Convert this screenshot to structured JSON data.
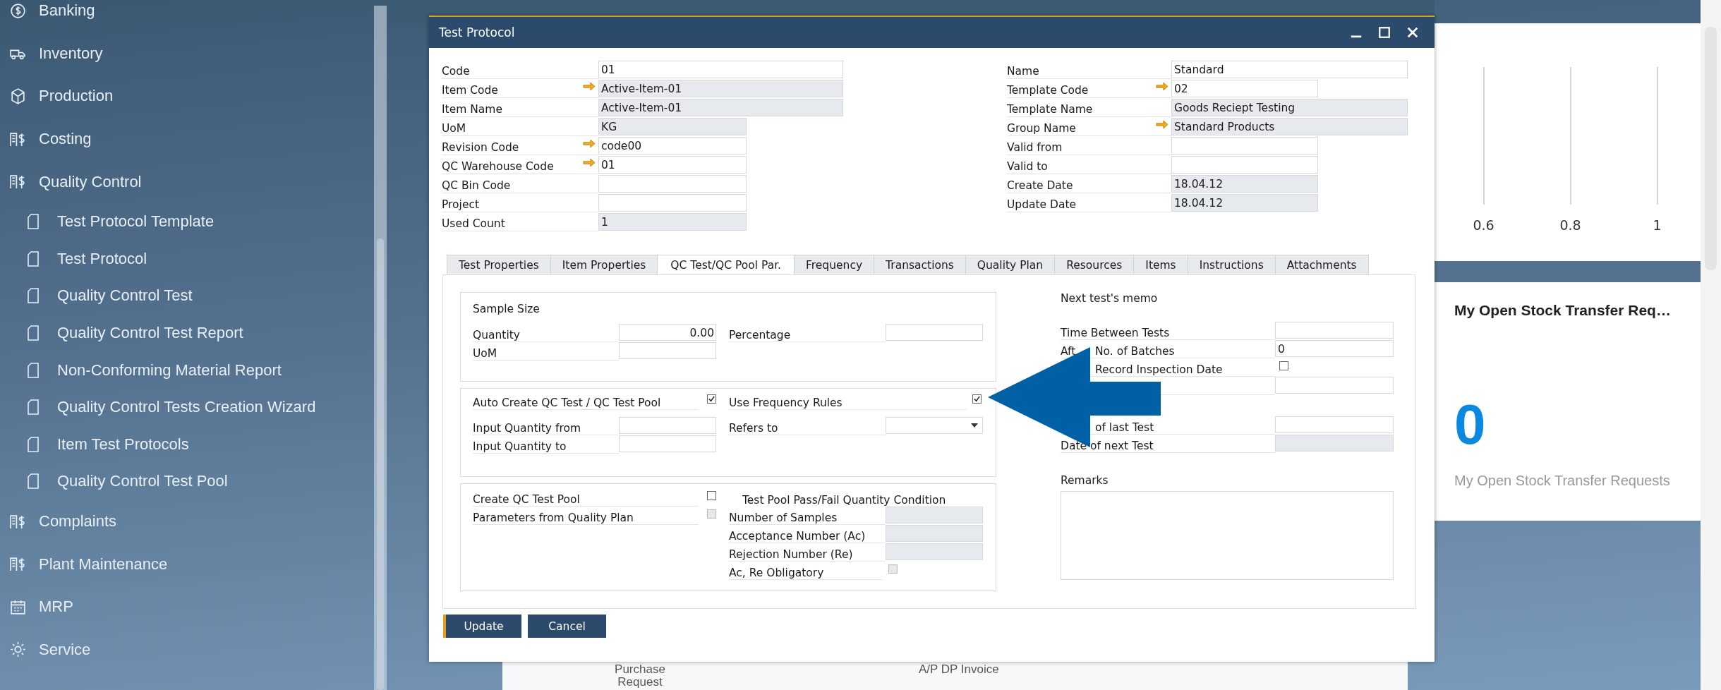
{
  "sidebar": {
    "items": [
      {
        "label": "Banking"
      },
      {
        "label": "Inventory"
      },
      {
        "label": "Production"
      },
      {
        "label": "Costing"
      },
      {
        "label": "Quality Control",
        "children": [
          {
            "label": "Test Protocol Template"
          },
          {
            "label": "Test Protocol"
          },
          {
            "label": "Quality Control Test"
          },
          {
            "label": "Quality Control Test Report"
          },
          {
            "label": "Non-Conforming Material Report"
          },
          {
            "label": "Quality Control Tests Creation Wizard"
          },
          {
            "label": "Item Test Protocols"
          },
          {
            "label": "Quality Control Test Pool"
          }
        ]
      },
      {
        "label": "Complaints"
      },
      {
        "label": "Plant Maintenance"
      },
      {
        "label": "MRP"
      },
      {
        "label": "Service"
      }
    ]
  },
  "dashboard": {
    "axis_labels": [
      "0.6",
      "0.8",
      "1"
    ],
    "kpi": {
      "title": "My Open Stock Transfer Req…",
      "value": "0",
      "caption": "My Open Stock Transfer Requests"
    },
    "shortcuts": [
      "Purchase Request",
      "A/P DP Invoice"
    ]
  },
  "dialog": {
    "title": "Test Protocol",
    "header_left": [
      {
        "label": "Code",
        "value": "01",
        "readonly": false,
        "link": false
      },
      {
        "label": "Item Code",
        "value": "Active-Item-01",
        "readonly": true,
        "link": true
      },
      {
        "label": "Item Name",
        "value": "Active-Item-01",
        "readonly": true,
        "link": false
      },
      {
        "label": "UoM",
        "value": "KG",
        "readonly": true,
        "link": false
      },
      {
        "label": "Revision Code",
        "value": "code00",
        "readonly": false,
        "link": true
      },
      {
        "label": "QC Warehouse Code",
        "value": "01",
        "readonly": false,
        "link": true
      },
      {
        "label": "QC Bin Code",
        "readonly": false,
        "link": false
      },
      {
        "label": "Project",
        "readonly": false,
        "link": false
      },
      {
        "label": "Used Count",
        "value": "1",
        "readonly": true,
        "link": false
      }
    ],
    "header_right": [
      {
        "label": "Name",
        "value": "Standard",
        "readonly": false,
        "link": false
      },
      {
        "label": "Template Code",
        "value": "02",
        "readonly": false,
        "link": true
      },
      {
        "label": "Template Name",
        "value": "Goods Reciept Testing",
        "readonly": true,
        "link": false
      },
      {
        "label": "Group Name",
        "value": "Standard Products",
        "readonly": true,
        "link": true
      },
      {
        "label": "Valid from",
        "readonly": false,
        "link": false
      },
      {
        "label": "Valid to",
        "readonly": false,
        "link": false
      },
      {
        "label": "Create Date",
        "value": "18.04.12",
        "readonly": true,
        "link": false
      },
      {
        "label": "Update Date",
        "value": "18.04.12",
        "readonly": true,
        "link": false
      }
    ],
    "tabs": [
      {
        "label": "Test Properties",
        "selected": false
      },
      {
        "label": "Item Properties",
        "selected": false
      },
      {
        "label": "QC Test/QC Pool Par.",
        "selected": true
      },
      {
        "label": "Frequency",
        "selected": false
      },
      {
        "label": "Transactions",
        "selected": false
      },
      {
        "label": "Quality Plan",
        "selected": false
      },
      {
        "label": "Resources",
        "selected": false
      },
      {
        "label": "Items",
        "selected": false
      },
      {
        "label": "Instructions",
        "selected": false
      },
      {
        "label": "Attachments",
        "selected": false
      }
    ],
    "groups": [
      {
        "title": "Sample Size",
        "rows": [
          {
            "left": {
              "kind": "field",
              "label": "Quantity",
              "value": "0.00",
              "readonly": false
            },
            "right": {
              "kind": "field",
              "label": "Percentage",
              "readonly": false
            }
          },
          {
            "left": {
              "kind": "field",
              "label": "UoM",
              "readonly": false
            }
          }
        ]
      },
      {
        "rows": [
          {
            "left": {
              "kind": "check",
              "label": "Auto Create QC Test / QC Test Pool",
              "checked": true,
              "disabled": false
            },
            "right": {
              "kind": "check",
              "label": "Use Frequency Rules",
              "checked": true,
              "disabled": false
            }
          },
          {
            "left": {
              "kind": "field",
              "label": "Input Quantity from",
              "readonly": false
            },
            "right": {
              "kind": "select",
              "label": "Refers to"
            }
          },
          {
            "left": {
              "kind": "field",
              "label": "Input Quantity to",
              "readonly": false
            }
          }
        ]
      },
      {
        "rows": [
          {
            "left": {
              "kind": "check",
              "label": "Create QC Test Pool",
              "checked": false,
              "disabled": false
            },
            "right": {
              "kind": "heading",
              "label": "Test Pool Pass/Fail Quantity Condition"
            }
          },
          {
            "left": {
              "kind": "check",
              "label": "Parameters from Quality Plan",
              "checked": false,
              "disabled": true
            },
            "right": {
              "kind": "field",
              "label": "Number of Samples",
              "readonly": true
            }
          },
          {
            "right": {
              "kind": "field",
              "label": "Acceptance Number (Ac)",
              "readonly": true
            }
          },
          {
            "right": {
              "kind": "field",
              "label": "Rejection Number (Re)",
              "readonly": true
            }
          },
          {
            "right": {
              "kind": "check",
              "label": "Ac, Re Obligatory",
              "checked": false,
              "disabled": true
            }
          }
        ]
      }
    ],
    "memo": {
      "title": "Next test's memo",
      "rows": [
        {
          "kind": "field",
          "label": "Time Between Tests",
          "covered": false
        },
        {
          "kind": "field",
          "lead": "Aft",
          "label": "No. of Batches",
          "value": "0",
          "covered": true
        },
        {
          "kind": "check",
          "label": "Record Inspection Date",
          "checked": false,
          "covered": true
        },
        {
          "kind": "field"
        }
      ],
      "dates": [
        {
          "label": "of last Test",
          "readonly": false,
          "covered": true
        },
        {
          "label": "Date of next Test",
          "readonly": true,
          "covered": false
        }
      ],
      "remarks": "Remarks"
    },
    "buttons": [
      {
        "label": "Update",
        "default": true
      },
      {
        "label": "Cancel",
        "default": false
      }
    ]
  }
}
